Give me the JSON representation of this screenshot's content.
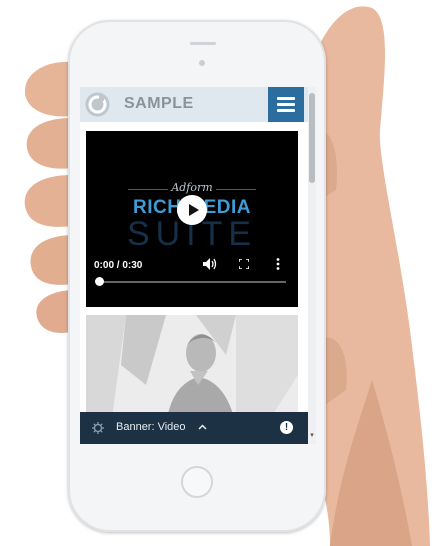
{
  "app": {
    "title": "SAMPLE",
    "menu_icon": "hamburger-menu-icon",
    "logo_icon": "ring-logo-icon",
    "accent_color": "#2b6d9f"
  },
  "video": {
    "brand_script": "Adform",
    "brand_main": "RICH MEDIA",
    "brand_sub": "SUITE",
    "time": "0:00 / 0:30",
    "progress": 0,
    "controls": [
      "play-icon",
      "volume-icon",
      "fullscreen-icon",
      "more-vertical-icon"
    ]
  },
  "bottom_bar": {
    "label": "Banner: Video",
    "icons": [
      "gear-icon",
      "chevron-up-icon",
      "alert-icon"
    ],
    "alert_glyph": "!"
  }
}
